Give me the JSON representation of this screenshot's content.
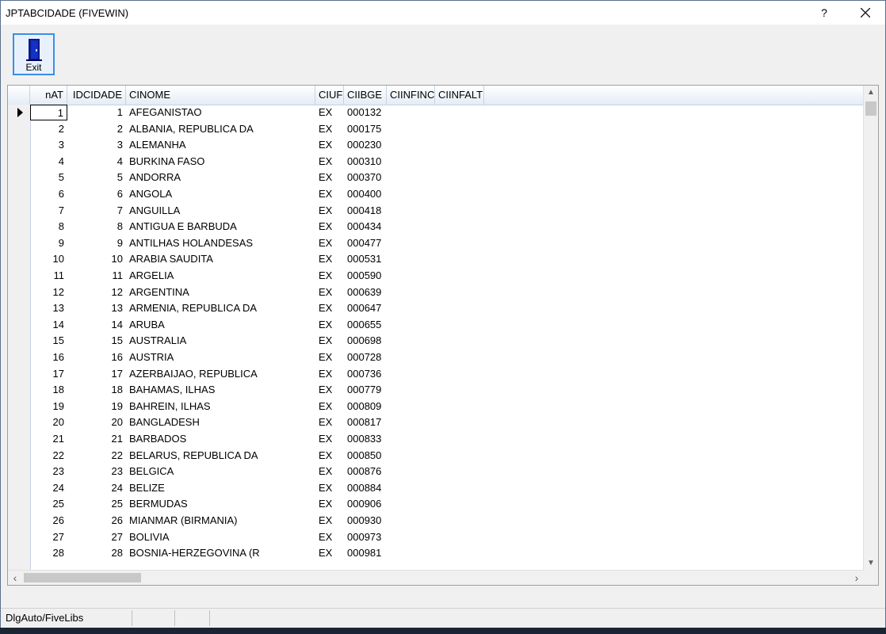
{
  "window": {
    "title": "JPTABCIDADE (FIVEWIN)",
    "help_label": "?"
  },
  "toolbar": {
    "exit_label": "Exit"
  },
  "grid": {
    "columns": [
      "nAT",
      "IDCIDADE",
      "CINOME",
      "CIUF",
      "CIIBGE",
      "CIINFINC",
      "CIINFALT"
    ],
    "rows": [
      [
        "1",
        "1",
        "AFEGANISTAO",
        "EX",
        "000132"
      ],
      [
        "2",
        "2",
        "ALBANIA, REPUBLICA DA",
        "EX",
        "000175"
      ],
      [
        "3",
        "3",
        "ALEMANHA",
        "EX",
        "000230"
      ],
      [
        "4",
        "4",
        "BURKINA FASO",
        "EX",
        "000310"
      ],
      [
        "5",
        "5",
        "ANDORRA",
        "EX",
        "000370"
      ],
      [
        "6",
        "6",
        "ANGOLA",
        "EX",
        "000400"
      ],
      [
        "7",
        "7",
        "ANGUILLA",
        "EX",
        "000418"
      ],
      [
        "8",
        "8",
        "ANTIGUA E BARBUDA",
        "EX",
        "000434"
      ],
      [
        "9",
        "9",
        "ANTILHAS HOLANDESAS",
        "EX",
        "000477"
      ],
      [
        "10",
        "10",
        "ARABIA SAUDITA",
        "EX",
        "000531"
      ],
      [
        "11",
        "11",
        "ARGELIA",
        "EX",
        "000590"
      ],
      [
        "12",
        "12",
        "ARGENTINA",
        "EX",
        "000639"
      ],
      [
        "13",
        "13",
        "ARMENIA, REPUBLICA DA",
        "EX",
        "000647"
      ],
      [
        "14",
        "14",
        "ARUBA",
        "EX",
        "000655"
      ],
      [
        "15",
        "15",
        "AUSTRALIA",
        "EX",
        "000698"
      ],
      [
        "16",
        "16",
        "AUSTRIA",
        "EX",
        "000728"
      ],
      [
        "17",
        "17",
        "AZERBAIJAO, REPUBLICA",
        "EX",
        "000736"
      ],
      [
        "18",
        "18",
        "BAHAMAS, ILHAS",
        "EX",
        "000779"
      ],
      [
        "19",
        "19",
        "BAHREIN, ILHAS",
        "EX",
        "000809"
      ],
      [
        "20",
        "20",
        "BANGLADESH",
        "EX",
        "000817"
      ],
      [
        "21",
        "21",
        "BARBADOS",
        "EX",
        "000833"
      ],
      [
        "22",
        "22",
        "BELARUS, REPUBLICA DA",
        "EX",
        "000850"
      ],
      [
        "23",
        "23",
        "BELGICA",
        "EX",
        "000876"
      ],
      [
        "24",
        "24",
        "BELIZE",
        "EX",
        "000884"
      ],
      [
        "25",
        "25",
        "BERMUDAS",
        "EX",
        "000906"
      ],
      [
        "26",
        "26",
        "MIANMAR (BIRMANIA)",
        "EX",
        "000930"
      ],
      [
        "27",
        "27",
        "BOLIVIA",
        "EX",
        "000973"
      ],
      [
        "28",
        "28",
        "BOSNIA-HERZEGOVINA (R",
        "EX",
        "000981"
      ]
    ]
  },
  "statusbar": {
    "text": "DlgAuto/FiveLibs"
  }
}
